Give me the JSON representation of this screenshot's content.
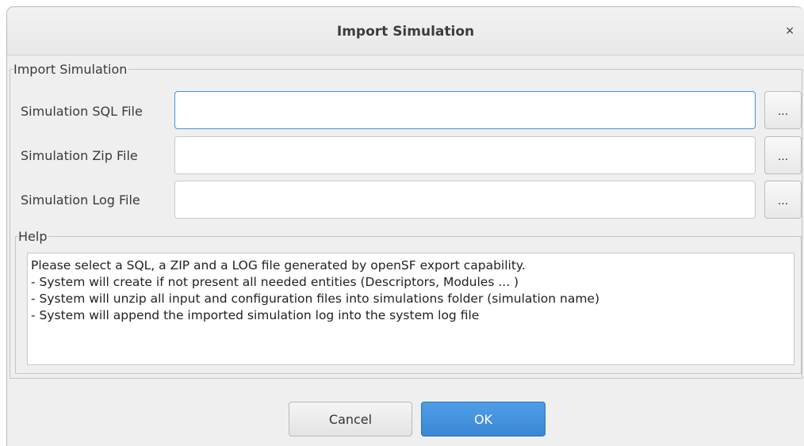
{
  "window": {
    "title": "Import Simulation",
    "close_label": "×"
  },
  "import_group": {
    "legend": "Import Simulation",
    "fields": [
      {
        "label": "Simulation SQL File",
        "value": "",
        "browse_label": "...",
        "focused": true
      },
      {
        "label": "Simulation Zip File",
        "value": "",
        "browse_label": "..."
      },
      {
        "label": "Simulation Log File",
        "value": "",
        "browse_label": "..."
      }
    ]
  },
  "help_group": {
    "legend": "Help",
    "lines": [
      "Please select a SQL, a ZIP and a LOG file generated by openSF export capability.",
      "- System will create if not present all needed entities (Descriptors, Modules ... )",
      "- System will unzip all input and configuration files into simulations folder (simulation name)",
      "- System will append the imported simulation log into the system log file"
    ]
  },
  "buttons": {
    "cancel": "Cancel",
    "ok": "OK"
  },
  "colors": {
    "accent": "#3b87d6",
    "focus_border": "#4a90d9",
    "dialog_bg": "#efefef"
  }
}
